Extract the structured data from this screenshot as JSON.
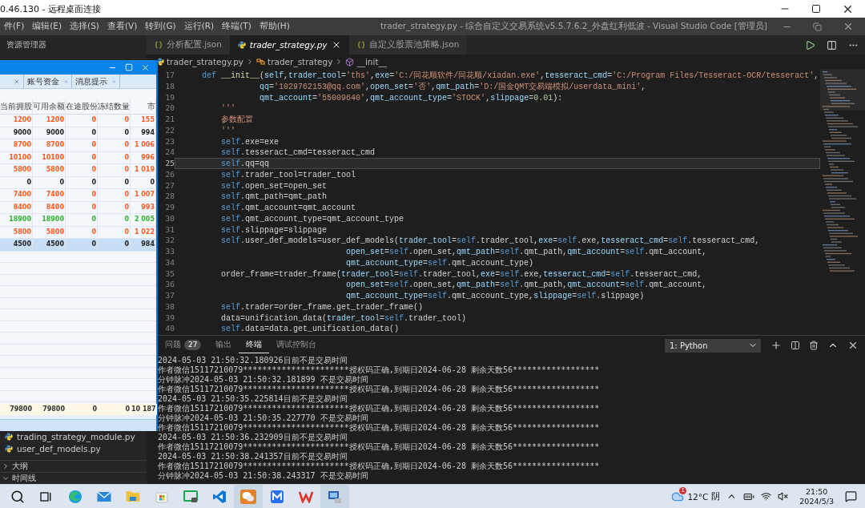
{
  "remote_window": {
    "title": "0.46.130 - 远程桌面连接"
  },
  "menu": [
    "件(F)",
    "编辑(E)",
    "选择(S)",
    "查看(V)",
    "转到(G)",
    "运行(R)",
    "终端(T)",
    "帮助(H)"
  ],
  "window_title": "trader_strategy.py - 综合自定义交易系统v5.5.7.6.2_外盘红利低波 - Visual Studio Code [管理员]",
  "sidebar": {
    "title": "资源管理器",
    "files": [
      "trading_strategy_module.py",
      "user_def_models.py"
    ],
    "sections": [
      {
        "label": "大纲",
        "expanded": false
      },
      {
        "label": "时间线",
        "expanded": true
      }
    ]
  },
  "editor_tabs": [
    {
      "label": "分析配置.json",
      "kind": "json",
      "selected": false
    },
    {
      "label": "trader_strategy.py",
      "kind": "python",
      "selected": true
    },
    {
      "label": "自定义股票池策略.json",
      "kind": "json",
      "selected": false
    }
  ],
  "breadcrumbs": [
    {
      "label": "trader_strategy.py",
      "kind": "file"
    },
    {
      "label": "trader_strategy",
      "kind": "class"
    },
    {
      "label": "__init__",
      "kind": "method"
    }
  ],
  "code_lines": [
    {
      "number": "17",
      "current": false,
      "tokens": [
        {
          "kind": "kw",
          "text": "    def"
        },
        {
          "kind": "fn",
          "text": " __init__"
        },
        {
          "kind": "text",
          "text": "("
        },
        {
          "kind": "param",
          "text": "self"
        },
        {
          "kind": "text",
          "text": ","
        },
        {
          "kind": "param",
          "text": "trader_tool"
        },
        {
          "kind": "text",
          "text": "="
        },
        {
          "kind": "str",
          "text": "'ths'"
        },
        {
          "kind": "text",
          "text": ","
        },
        {
          "kind": "param",
          "text": "exe"
        },
        {
          "kind": "text",
          "text": "="
        },
        {
          "kind": "str",
          "text": "'C:/同花顺软件/同花顺/xiadan.exe'"
        },
        {
          "kind": "text",
          "text": ","
        },
        {
          "kind": "param",
          "text": "tesseract_cmd"
        },
        {
          "kind": "text",
          "text": "="
        },
        {
          "kind": "str",
          "text": "'C:/Program Files/Tesseract-OCR/tesseract'"
        },
        {
          "kind": "text",
          "text": ","
        }
      ]
    },
    {
      "number": "18",
      "current": false,
      "tokens": [
        {
          "kind": "param",
          "text": "                qq"
        },
        {
          "kind": "text",
          "text": "="
        },
        {
          "kind": "str",
          "text": "'1029762153@qq.com'"
        },
        {
          "kind": "text",
          "text": ","
        },
        {
          "kind": "param",
          "text": "open_set"
        },
        {
          "kind": "text",
          "text": "="
        },
        {
          "kind": "str",
          "text": "'否'"
        },
        {
          "kind": "text",
          "text": ","
        },
        {
          "kind": "param",
          "text": "qmt_path"
        },
        {
          "kind": "text",
          "text": "="
        },
        {
          "kind": "str",
          "text": "'D:/国金QMT交易端模拟/userdata_mini'"
        },
        {
          "kind": "text",
          "text": ","
        }
      ]
    },
    {
      "number": "19",
      "current": false,
      "tokens": [
        {
          "kind": "param",
          "text": "                qmt_account"
        },
        {
          "kind": "text",
          "text": "="
        },
        {
          "kind": "str",
          "text": "'55009640'"
        },
        {
          "kind": "text",
          "text": ","
        },
        {
          "kind": "param",
          "text": "qmt_account_type"
        },
        {
          "kind": "text",
          "text": "="
        },
        {
          "kind": "str",
          "text": "'STOCK'"
        },
        {
          "kind": "text",
          "text": ","
        },
        {
          "kind": "param",
          "text": "slippage"
        },
        {
          "kind": "text",
          "text": "="
        },
        {
          "kind": "num",
          "text": "0.01"
        },
        {
          "kind": "text",
          "text": "):"
        }
      ]
    },
    {
      "number": "20",
      "current": false,
      "tokens": [
        {
          "kind": "str",
          "text": "        '''"
        }
      ]
    },
    {
      "number": "21",
      "current": false,
      "tokens": [
        {
          "kind": "str",
          "text": "        参数配置"
        }
      ]
    },
    {
      "number": "22",
      "current": false,
      "tokens": [
        {
          "kind": "str",
          "text": "        '''"
        }
      ]
    },
    {
      "number": "23",
      "current": false,
      "tokens": [
        {
          "kind": "self",
          "text": "        self"
        },
        {
          "kind": "text",
          "text": ".exe=exe"
        }
      ]
    },
    {
      "number": "24",
      "current": false,
      "tokens": [
        {
          "kind": "self",
          "text": "        self"
        },
        {
          "kind": "text",
          "text": ".tesseract_cmd=tesseract_cmd"
        }
      ]
    },
    {
      "number": "25",
      "current": true,
      "tokens": [
        {
          "kind": "self",
          "text": "        self"
        },
        {
          "kind": "text",
          "text": ".qq=qq"
        }
      ]
    },
    {
      "number": "26",
      "current": false,
      "tokens": [
        {
          "kind": "self",
          "text": "        self"
        },
        {
          "kind": "text",
          "text": ".trader_tool=trader_tool"
        }
      ]
    },
    {
      "number": "27",
      "current": false,
      "tokens": [
        {
          "kind": "self",
          "text": "        self"
        },
        {
          "kind": "text",
          "text": ".open_set=open_set"
        }
      ]
    },
    {
      "number": "28",
      "current": false,
      "tokens": [
        {
          "kind": "self",
          "text": "        self"
        },
        {
          "kind": "text",
          "text": ".qmt_path=qmt_path"
        }
      ]
    },
    {
      "number": "29",
      "current": false,
      "tokens": [
        {
          "kind": "self",
          "text": "        self"
        },
        {
          "kind": "text",
          "text": ".qmt_account=qmt_account"
        }
      ]
    },
    {
      "number": "30",
      "current": false,
      "tokens": [
        {
          "kind": "self",
          "text": "        self"
        },
        {
          "kind": "text",
          "text": ".qmt_account_type=qmt_account_type"
        }
      ]
    },
    {
      "number": "31",
      "current": false,
      "tokens": [
        {
          "kind": "self",
          "text": "        self"
        },
        {
          "kind": "text",
          "text": ".slippage=slippage"
        }
      ]
    },
    {
      "number": "32",
      "current": false,
      "tokens": [
        {
          "kind": "self",
          "text": "        self"
        },
        {
          "kind": "text",
          "text": ".user_def_models=user_def_models("
        },
        {
          "kind": "param",
          "text": "trader_tool"
        },
        {
          "kind": "text",
          "text": "="
        },
        {
          "kind": "self",
          "text": "self"
        },
        {
          "kind": "text",
          "text": ".trader_tool,"
        },
        {
          "kind": "param",
          "text": "exe"
        },
        {
          "kind": "text",
          "text": "="
        },
        {
          "kind": "self",
          "text": "self"
        },
        {
          "kind": "text",
          "text": ".exe,"
        },
        {
          "kind": "param",
          "text": "tesseract_cmd"
        },
        {
          "kind": "text",
          "text": "="
        },
        {
          "kind": "self",
          "text": "self"
        },
        {
          "kind": "text",
          "text": ".tesseract_cmd,"
        }
      ]
    },
    {
      "number": "33",
      "current": false,
      "tokens": [
        {
          "kind": "param",
          "text": "                                  open_set"
        },
        {
          "kind": "text",
          "text": "="
        },
        {
          "kind": "self",
          "text": "self"
        },
        {
          "kind": "text",
          "text": ".open_set,"
        },
        {
          "kind": "param",
          "text": "qmt_path"
        },
        {
          "kind": "text",
          "text": "="
        },
        {
          "kind": "self",
          "text": "self"
        },
        {
          "kind": "text",
          "text": ".qmt_path,"
        },
        {
          "kind": "param",
          "text": "qmt_account"
        },
        {
          "kind": "text",
          "text": "="
        },
        {
          "kind": "self",
          "text": "self"
        },
        {
          "kind": "text",
          "text": ".qmt_account,"
        }
      ]
    },
    {
      "number": "34",
      "current": false,
      "tokens": [
        {
          "kind": "param",
          "text": "                                  qmt_account_type"
        },
        {
          "kind": "text",
          "text": "="
        },
        {
          "kind": "self",
          "text": "self"
        },
        {
          "kind": "text",
          "text": ".qmt_account_type)"
        }
      ]
    },
    {
      "number": "35",
      "current": false,
      "tokens": [
        {
          "kind": "text",
          "text": "        order_frame=trader_frame("
        },
        {
          "kind": "param",
          "text": "trader_tool"
        },
        {
          "kind": "text",
          "text": "="
        },
        {
          "kind": "self",
          "text": "self"
        },
        {
          "kind": "text",
          "text": ".trader_tool,"
        },
        {
          "kind": "param",
          "text": "exe"
        },
        {
          "kind": "text",
          "text": "="
        },
        {
          "kind": "self",
          "text": "self"
        },
        {
          "kind": "text",
          "text": ".exe,"
        },
        {
          "kind": "param",
          "text": "tesseract_cmd"
        },
        {
          "kind": "text",
          "text": "="
        },
        {
          "kind": "self",
          "text": "self"
        },
        {
          "kind": "text",
          "text": ".tesseract_cmd,"
        }
      ]
    },
    {
      "number": "36",
      "current": false,
      "tokens": [
        {
          "kind": "param",
          "text": "                                  open_set"
        },
        {
          "kind": "text",
          "text": "="
        },
        {
          "kind": "self",
          "text": "self"
        },
        {
          "kind": "text",
          "text": ".open_set,"
        },
        {
          "kind": "param",
          "text": "qmt_path"
        },
        {
          "kind": "text",
          "text": "="
        },
        {
          "kind": "self",
          "text": "self"
        },
        {
          "kind": "text",
          "text": ".qmt_path,"
        },
        {
          "kind": "param",
          "text": "qmt_account"
        },
        {
          "kind": "text",
          "text": "="
        },
        {
          "kind": "self",
          "text": "self"
        },
        {
          "kind": "text",
          "text": ".qmt_account,"
        }
      ]
    },
    {
      "number": "37",
      "current": false,
      "tokens": [
        {
          "kind": "param",
          "text": "                                  qmt_account_type"
        },
        {
          "kind": "text",
          "text": "="
        },
        {
          "kind": "self",
          "text": "self"
        },
        {
          "kind": "text",
          "text": ".qmt_account_type,"
        },
        {
          "kind": "param",
          "text": "slippage"
        },
        {
          "kind": "text",
          "text": "="
        },
        {
          "kind": "self",
          "text": "self"
        },
        {
          "kind": "text",
          "text": ".slippage)"
        }
      ]
    },
    {
      "number": "38",
      "current": false,
      "tokens": [
        {
          "kind": "self",
          "text": "        self"
        },
        {
          "kind": "text",
          "text": ".trader=order_frame.get_trader_frame()"
        }
      ]
    },
    {
      "number": "39",
      "current": false,
      "tokens": [
        {
          "kind": "text",
          "text": "        data=unification_data("
        },
        {
          "kind": "param",
          "text": "trader_tool"
        },
        {
          "kind": "text",
          "text": "="
        },
        {
          "kind": "self",
          "text": "self"
        },
        {
          "kind": "text",
          "text": ".trader_tool)"
        }
      ]
    },
    {
      "number": "40",
      "current": false,
      "tokens": [
        {
          "kind": "self",
          "text": "        self"
        },
        {
          "kind": "text",
          "text": ".data=data.get_unification_data()"
        }
      ]
    }
  ],
  "panel": {
    "tabs": [
      {
        "label": "问题",
        "badge": "27",
        "selected": false
      },
      {
        "label": "输出",
        "selected": false
      },
      {
        "label": "终端",
        "selected": true
      },
      {
        "label": "调试控制台",
        "selected": false
      }
    ],
    "terminal_select": "1: Python",
    "terminal_lines": [
      "2024-05-03 21:50:32.180926目前不是交易时间",
      "作者微信15117210079**********************授权码正确,到期日2024-06-28 剩余天数56******************",
      "分钟脉冲2024-05-03 21:50:32.181899 不是交易时间",
      "作者微信15117210079**********************授权码正确,到期日2024-06-28 剩余天数56******************",
      "2024-05-03 21:50:35.225814目前不是交易时间",
      "作者微信15117210079**********************授权码正确,到期日2024-06-28 剩余天数56******************",
      "分钟脉冲2024-05-03 21:50:35.227770 不是交易时间",
      "作者微信15117210079**********************授权码正确,到期日2024-06-28 剩余天数56******************",
      "2024-05-03 21:50:36.232909目前不是交易时间",
      "作者微信15117210079**********************授权码正确,到期日2024-06-28 剩余天数56******************",
      "2024-05-03 21:50:38.241357目前不是交易时间",
      "作者微信15117210079**********************授权码正确,到期日2024-06-28 剩余天数56******************",
      "分钟脉冲2024-05-03 21:50:38.243317 不是交易时间"
    ]
  },
  "trading_window": {
    "tabs": [
      {
        "selected": false
      },
      {
        "label": "账号资金",
        "selected": false
      },
      {
        "label": "消息提示",
        "selected": false
      }
    ],
    "columns": [
      "当前拥股",
      "可用余额",
      "在途股份",
      "冻结数量",
      "市"
    ],
    "rows": [
      {
        "cells": [
          "1200",
          "1200",
          "0",
          "0",
          "155"
        ],
        "color": "#ff5a1f",
        "selected": false
      },
      {
        "cells": [
          "9000",
          "9000",
          "0",
          "0",
          "994"
        ],
        "color": "#222222",
        "selected": false
      },
      {
        "cells": [
          "8700",
          "8700",
          "0",
          "0",
          "1 006"
        ],
        "color": "#ff5a1f",
        "selected": false
      },
      {
        "cells": [
          "10100",
          "10100",
          "0",
          "0",
          "996"
        ],
        "color": "#ff5a1f",
        "selected": false
      },
      {
        "cells": [
          "5800",
          "5800",
          "0",
          "0",
          "1 019"
        ],
        "color": "#ff5a1f",
        "selected": false
      },
      {
        "cells": [
          "0",
          "0",
          "0",
          "0",
          "0"
        ],
        "color": "#222222",
        "selected": false
      },
      {
        "cells": [
          "7400",
          "7400",
          "0",
          "0",
          "1 007"
        ],
        "color": "#ff5a1f",
        "selected": false
      },
      {
        "cells": [
          "8400",
          "8400",
          "0",
          "0",
          "993"
        ],
        "color": "#ff5a1f",
        "selected": false
      },
      {
        "cells": [
          "18900",
          "18900",
          "0",
          "0",
          "2 005"
        ],
        "color": "#2fb52f",
        "selected": false
      },
      {
        "cells": [
          "5800",
          "5800",
          "0",
          "0",
          "1 022"
        ],
        "color": "#ff5a1f",
        "selected": false
      },
      {
        "cells": [
          "4500",
          "4500",
          "0",
          "0",
          "984"
        ],
        "color": "#222222",
        "selected": true
      }
    ],
    "totals": [
      "79800",
      "79800",
      "0",
      "0",
      "10 187"
    ]
  },
  "taskbar": {
    "apps": [
      {
        "kind": "search",
        "selected": false
      },
      {
        "kind": "taskview",
        "selected": false
      },
      {
        "kind": "edge",
        "selected": false
      },
      {
        "kind": "mail",
        "selected": false
      },
      {
        "kind": "folder",
        "selected": false
      },
      {
        "kind": "store",
        "selected": false
      },
      {
        "kind": "terminal",
        "selected": false
      },
      {
        "kind": "vscode",
        "selected": false
      },
      {
        "kind": "wechat",
        "selected": true
      },
      {
        "kind": "mapp",
        "selected": false
      },
      {
        "kind": "wps",
        "selected": false
      },
      {
        "kind": "remote",
        "selected": true
      }
    ],
    "weather": {
      "badge": "1",
      "temperature": "12°C",
      "condition": "阴"
    },
    "time": "21:50",
    "date": "2024/5/3"
  }
}
